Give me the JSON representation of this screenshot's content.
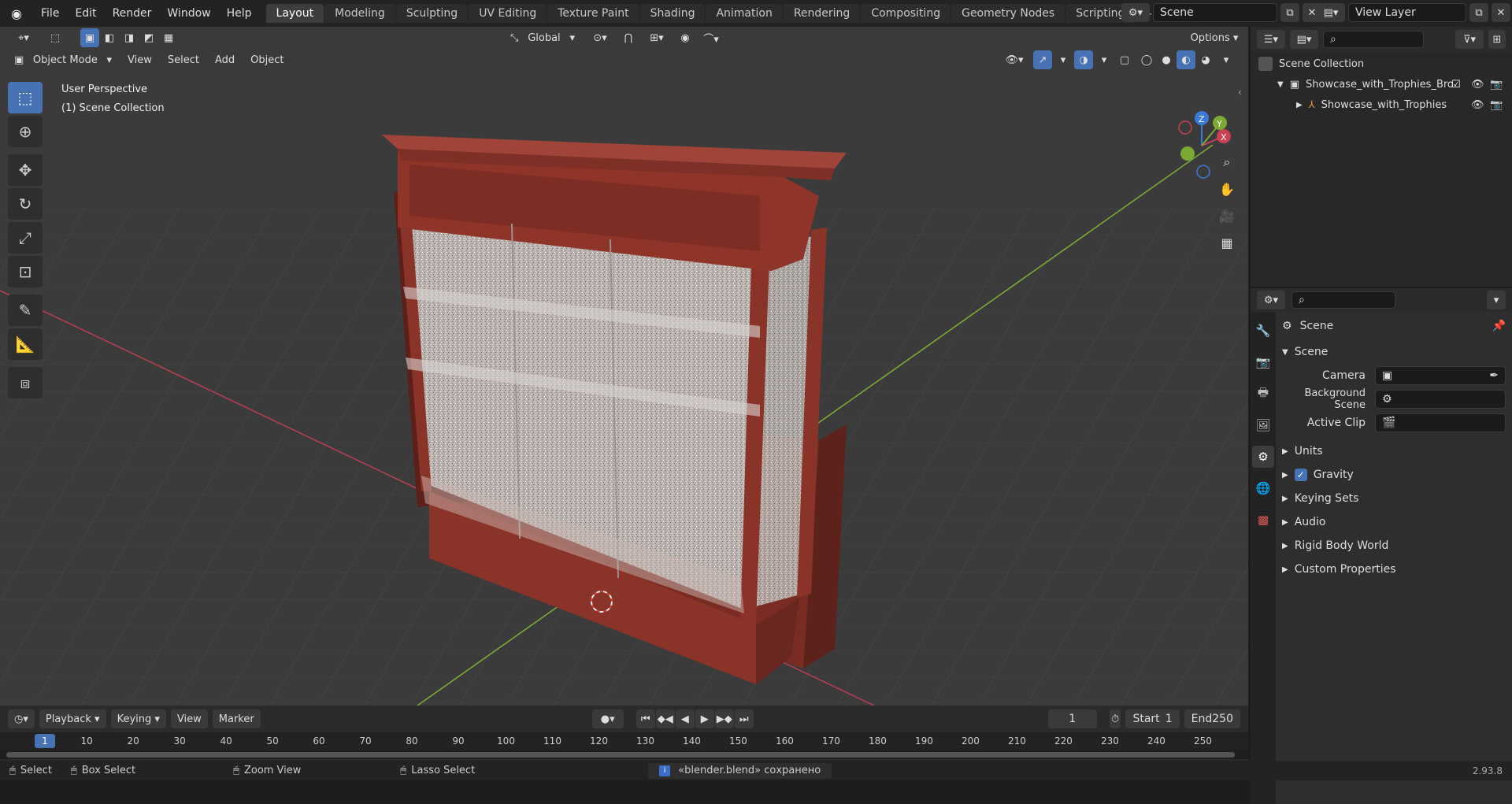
{
  "topbar": {
    "menus": [
      "File",
      "Edit",
      "Render",
      "Window",
      "Help"
    ],
    "workspaces": [
      "Layout",
      "Modeling",
      "Sculpting",
      "UV Editing",
      "Texture Paint",
      "Shading",
      "Animation",
      "Rendering",
      "Compositing",
      "Geometry Nodes",
      "Scripting"
    ],
    "active_workspace": "Layout",
    "add_tab": "+",
    "scene": "Scene",
    "view_layer": "View Layer"
  },
  "viewport": {
    "transform_orientation": "Global",
    "options_label": "Options",
    "mode": "Object Mode",
    "menus": [
      "View",
      "Select",
      "Add",
      "Object"
    ],
    "overlay_line1": "User Perspective",
    "overlay_line2": "(1) Scene Collection",
    "axes": {
      "x": "X",
      "y": "Y",
      "z": "Z"
    }
  },
  "outliner": {
    "root": "Scene Collection",
    "items": [
      {
        "label": "Showcase_with_Trophies_Bro"
      },
      {
        "label": "Showcase_with_Trophies"
      }
    ]
  },
  "properties": {
    "context": "Scene",
    "section": "Scene",
    "fields": [
      {
        "label": "Camera"
      },
      {
        "label": "Background Scene"
      },
      {
        "label": "Active Clip"
      }
    ],
    "panels": [
      "Units",
      "Gravity",
      "Keying Sets",
      "Audio",
      "Rigid Body World",
      "Custom Properties"
    ],
    "gravity_checked": true
  },
  "timeline": {
    "menus": [
      "Playback",
      "Keying",
      "View",
      "Marker"
    ],
    "current_frame": "1",
    "start_label": "Start",
    "start_value": "1",
    "end_label": "End",
    "end_value": "250",
    "ruler": [
      "1",
      "10",
      "20",
      "30",
      "40",
      "50",
      "60",
      "70",
      "80",
      "90",
      "100",
      "110",
      "120",
      "130",
      "140",
      "150",
      "160",
      "170",
      "180",
      "190",
      "200",
      "210",
      "220",
      "230",
      "240",
      "250"
    ]
  },
  "statusbar": {
    "select": "Select",
    "box_select": "Box Select",
    "zoom_view": "Zoom View",
    "lasso_select": "Lasso Select",
    "message": "«blender.blend» сохранено",
    "version": "2.93.8"
  },
  "colors": {
    "accent": "#4772b3",
    "cabinet": "#8a3328",
    "x_axis": "#c94152",
    "y_axis": "#7ca834",
    "z_axis": "#3b79d8"
  }
}
